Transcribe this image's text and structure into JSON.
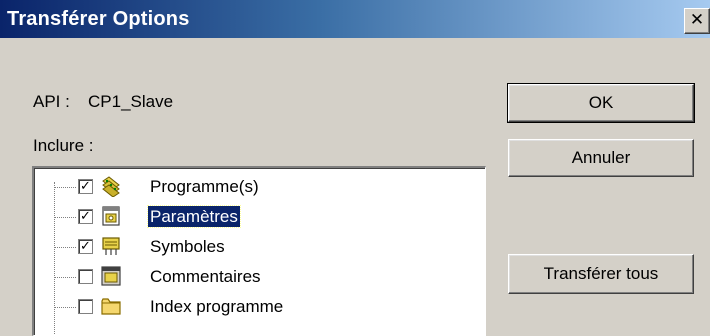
{
  "window": {
    "title": "Transférer Options",
    "close_glyph": "✕"
  },
  "api": {
    "label": "API :",
    "value": "CP1_Slave"
  },
  "include_label": "Inclure :",
  "buttons": {
    "ok": "OK",
    "cancel": "Annuler",
    "transfer_all": "Transférer tous"
  },
  "tree": {
    "items": [
      {
        "label": "Programme(s)",
        "checked": true,
        "icon": "program-icon",
        "selected": false
      },
      {
        "label": "Paramètres",
        "checked": true,
        "icon": "parameters-icon",
        "selected": true
      },
      {
        "label": "Symboles",
        "checked": true,
        "icon": "symbols-icon",
        "selected": false
      },
      {
        "label": "Commentaires",
        "checked": false,
        "icon": "comments-icon",
        "selected": false
      },
      {
        "label": "Index programme",
        "checked": false,
        "icon": "folder-icon",
        "selected": false
      }
    ]
  },
  "colors": {
    "title_start": "#0a246a",
    "title_end": "#a6caf0",
    "face": "#d4d0c8",
    "selection": "#0a246a"
  }
}
